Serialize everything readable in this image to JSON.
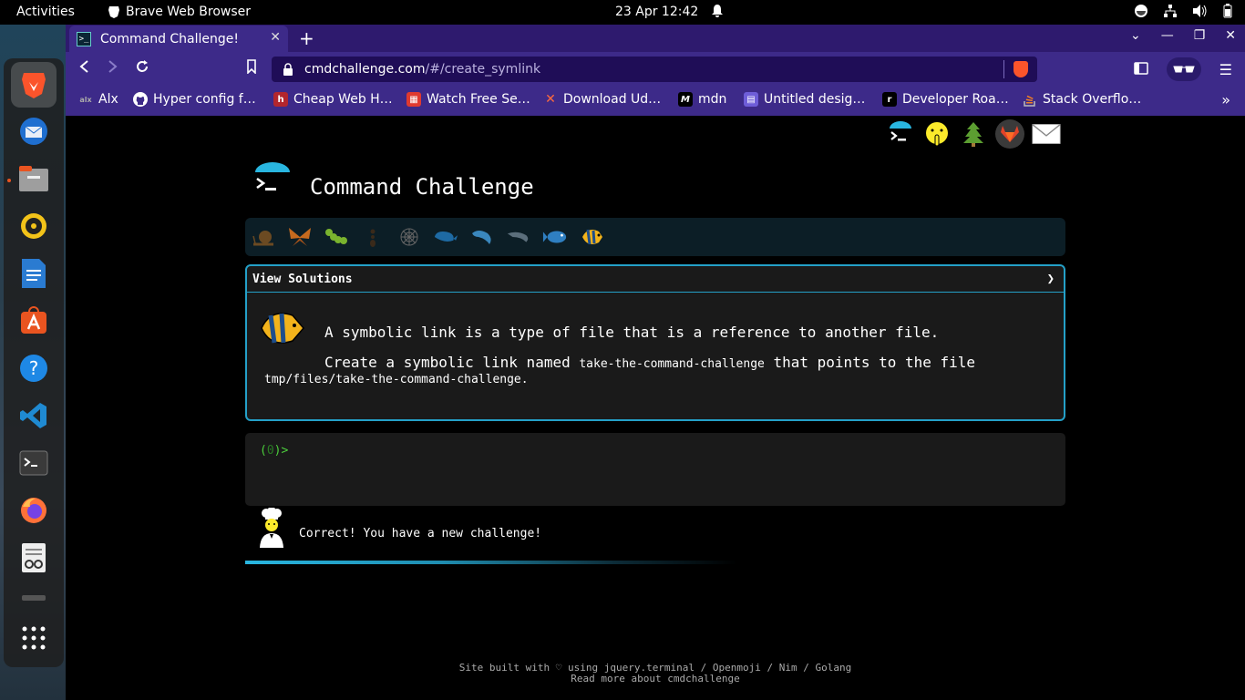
{
  "system": {
    "activities": "Activities",
    "app_name": "Brave Web Browser",
    "clock": "23 Apr  12:42"
  },
  "browser": {
    "tab_title": "Command Challenge!",
    "url_host": "cmdchallenge.com",
    "url_path": "/#/create_symlink",
    "bookmarks": [
      {
        "label": "Alx",
        "icon": "alx-icon",
        "color": "#3d2a89"
      },
      {
        "label": "Hyper config f…",
        "icon": "github-icon",
        "color": "#000000"
      },
      {
        "label": "Cheap Web H…",
        "icon": "hostinger-icon",
        "color": "#b3262d"
      },
      {
        "label": "Watch Free Se…",
        "icon": "film-icon",
        "color": "#e03a2f"
      },
      {
        "label": "Download Ud…",
        "icon": "x-icon",
        "color": "#e0522f"
      },
      {
        "label": "mdn",
        "icon": "mdn-icon",
        "color": "#000000"
      },
      {
        "label": "Untitled desig…",
        "icon": "canva-icon",
        "color": "#6e5dd8"
      },
      {
        "label": "Developer Roa…",
        "icon": "roadmap-icon",
        "color": "#000000"
      },
      {
        "label": "Stack Overflo…",
        "icon": "stackoverflow-icon",
        "color": "#f48024"
      }
    ]
  },
  "page": {
    "title": "Command Challenge",
    "card_header": "View Solutions",
    "description_line1": "A symbolic link is a type of file that is a reference to another file.",
    "description_line2_prefix": "Create a symbolic link named ",
    "description_code1": "take-the-command-challenge",
    "description_line2_suffix": " that points to the file",
    "description_code2": "tmp/files/take-the-command-challenge.",
    "prompt_open": "(",
    "prompt_count": "0",
    "prompt_close": ")>",
    "message": "Correct! You have a new challenge!",
    "progress_fraction": 0.6,
    "footer_line1": "Site built with ♡ using jquery.terminal / Openmoji / Nim / Golang",
    "footer_line2": "Read more about cmdchallenge"
  }
}
